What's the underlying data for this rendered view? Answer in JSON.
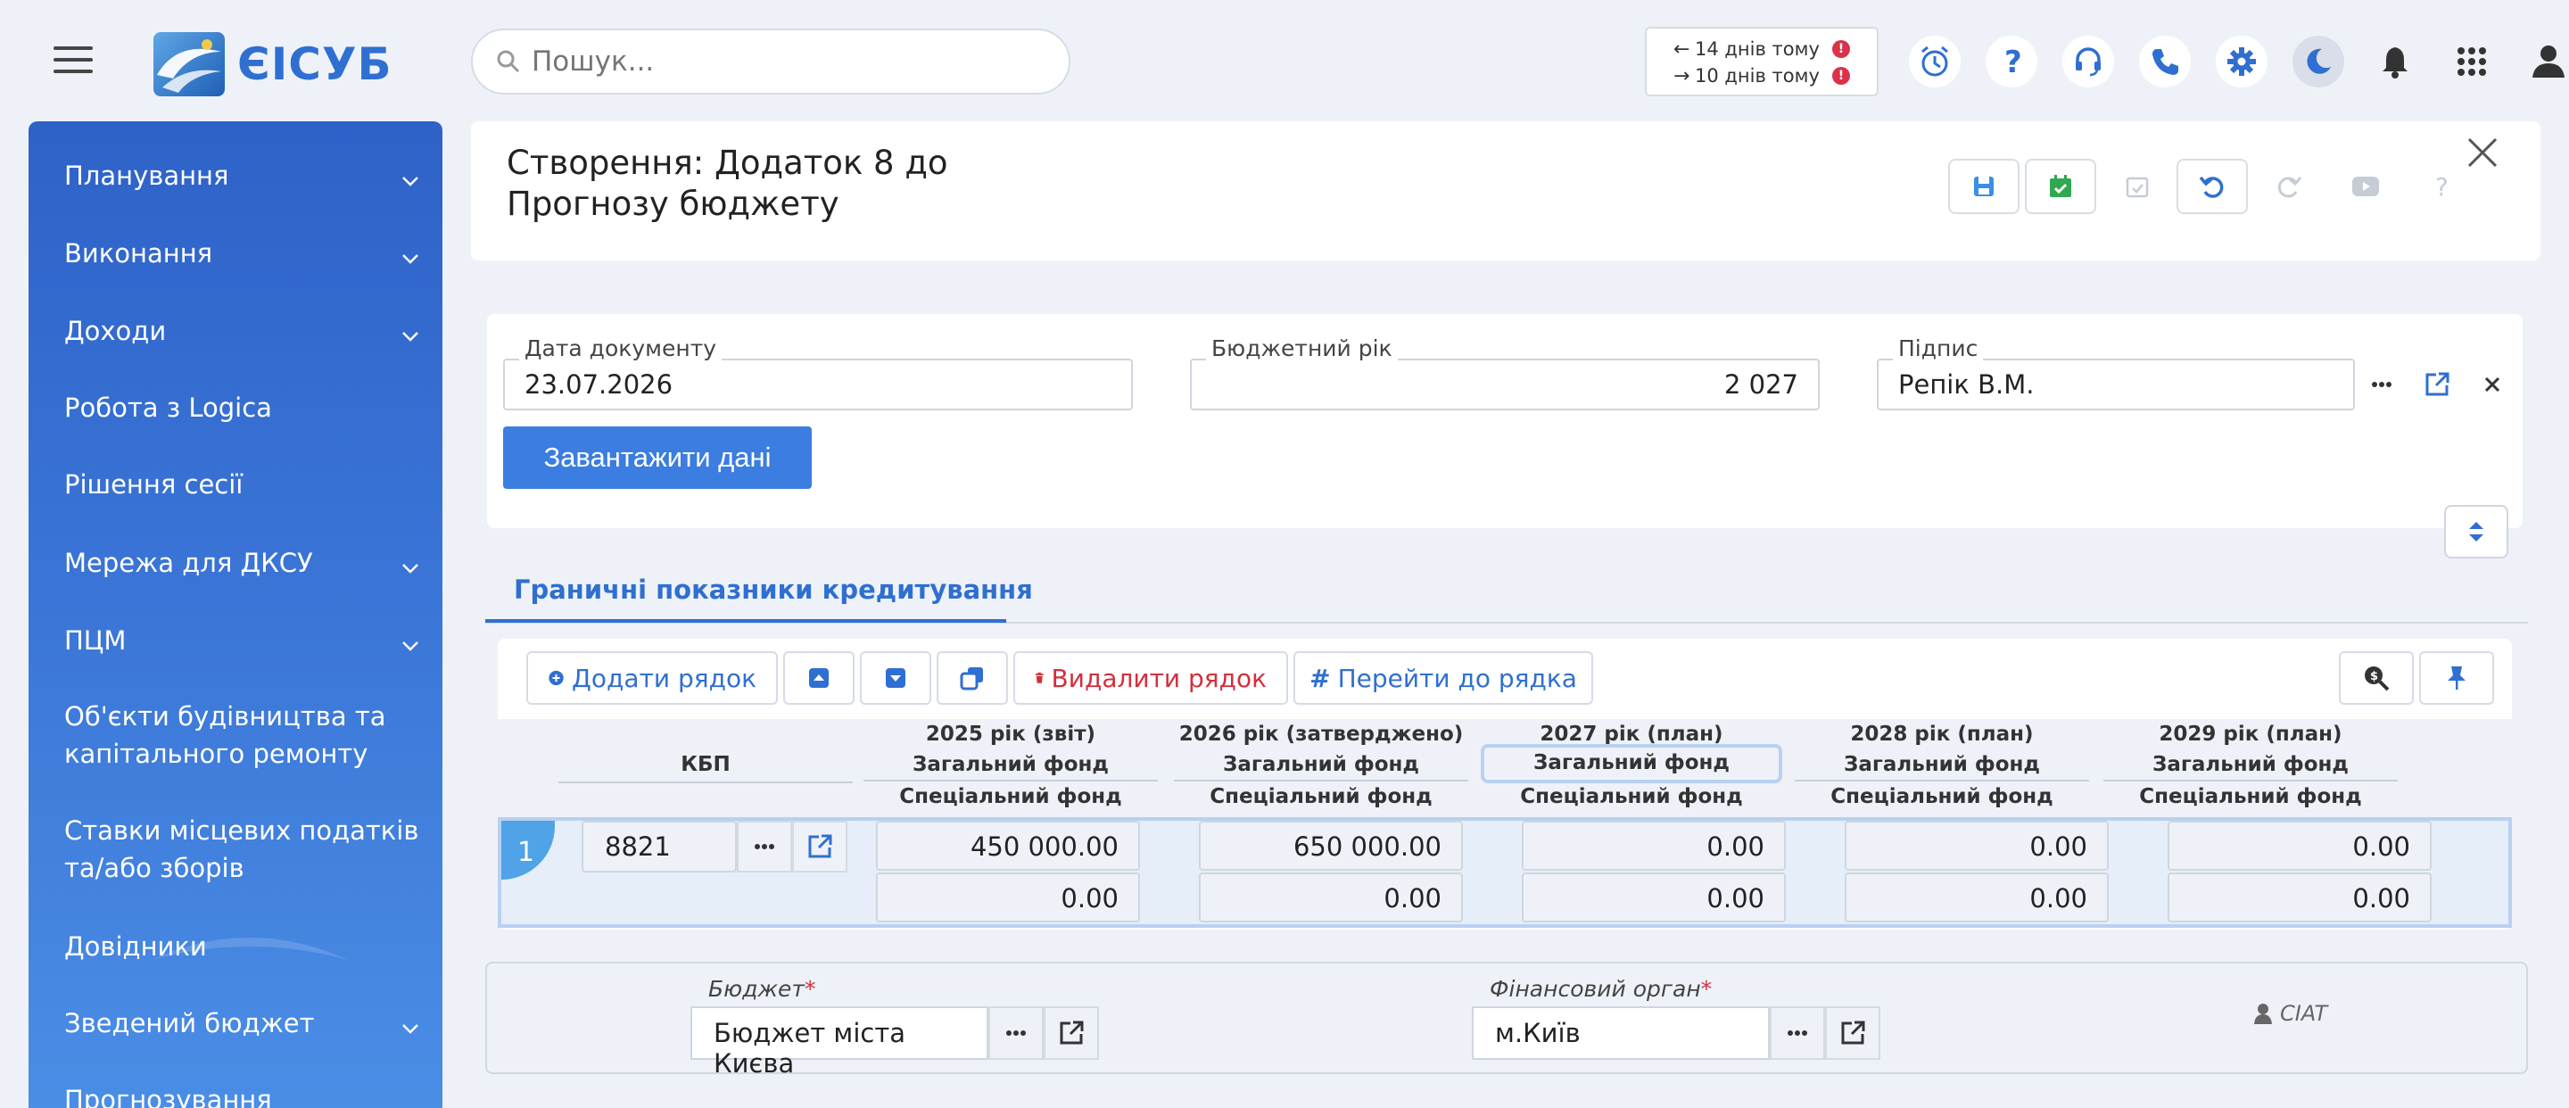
{
  "app": {
    "name": "ЄІСУБ"
  },
  "search": {
    "placeholder": "Пошук..."
  },
  "history": [
    {
      "direction": "back",
      "label": "14 днів тому",
      "badge": "!"
    },
    {
      "direction": "forward",
      "label": "10 днів тому",
      "badge": "!"
    }
  ],
  "sidebar": {
    "items": [
      {
        "label": "Планування",
        "expandable": true
      },
      {
        "label": "Виконання",
        "expandable": true
      },
      {
        "label": "Доходи",
        "expandable": true
      },
      {
        "label": "Робота з Logica",
        "expandable": false
      },
      {
        "label": "Рішення сесії",
        "expandable": false
      },
      {
        "label": "Мережа для ДКСУ",
        "expandable": true
      },
      {
        "label": "ПЦМ",
        "expandable": true
      },
      {
        "label": "Об'єкти будівництва та капітального ремонту",
        "expandable": false
      },
      {
        "label": "Ставки місцевих податків та/або зборів",
        "expandable": false
      },
      {
        "label": "Довідники",
        "expandable": false
      },
      {
        "label": "Зведений бюджет",
        "expandable": true
      },
      {
        "label": "Прогнозування",
        "expandable": false
      }
    ]
  },
  "document": {
    "title": "Створення: Додаток 8 до Прогнозу бюджету",
    "date_label": "Дата документу",
    "date_value": "23.07.2026",
    "year_label": "Бюджетний рік",
    "year_value": "2 027",
    "sign_label": "Підпис",
    "sign_value": "Репік В.М.",
    "load_button": "Завантажити дані"
  },
  "tab": {
    "label": "Граничні показники кредитування"
  },
  "grid": {
    "toolbar": {
      "add_row": "Додати рядок",
      "delete_row": "Видалити рядок",
      "goto_row": "Перейти до рядка"
    },
    "kbp_header": "КБП",
    "years": [
      "2025 рік (звіт)",
      "2026 рік (затверджено)",
      "2027 рік (план)",
      "2028 рік (план)",
      "2029 рік (план)"
    ],
    "fund_general": "Загальний фонд",
    "fund_special": "Спеціальний фонд",
    "rows": [
      {
        "number": "1",
        "kbp": "8821",
        "general": [
          "450 000.00",
          "650 000.00",
          "0.00",
          "0.00",
          "0.00"
        ],
        "special": [
          "0.00",
          "0.00",
          "0.00",
          "0.00",
          "0.00"
        ]
      }
    ]
  },
  "footer": {
    "budget_label": "Бюджет",
    "budget_value": "Бюджет міста Києва",
    "fin_label": "Фінансовий орган",
    "fin_value": "м.Київ",
    "user": "CIAT"
  },
  "colors": {
    "accent": "#3b7de0",
    "sidebar": "#2e62c8",
    "danger": "#d32f3c",
    "success": "#2fa84f"
  }
}
